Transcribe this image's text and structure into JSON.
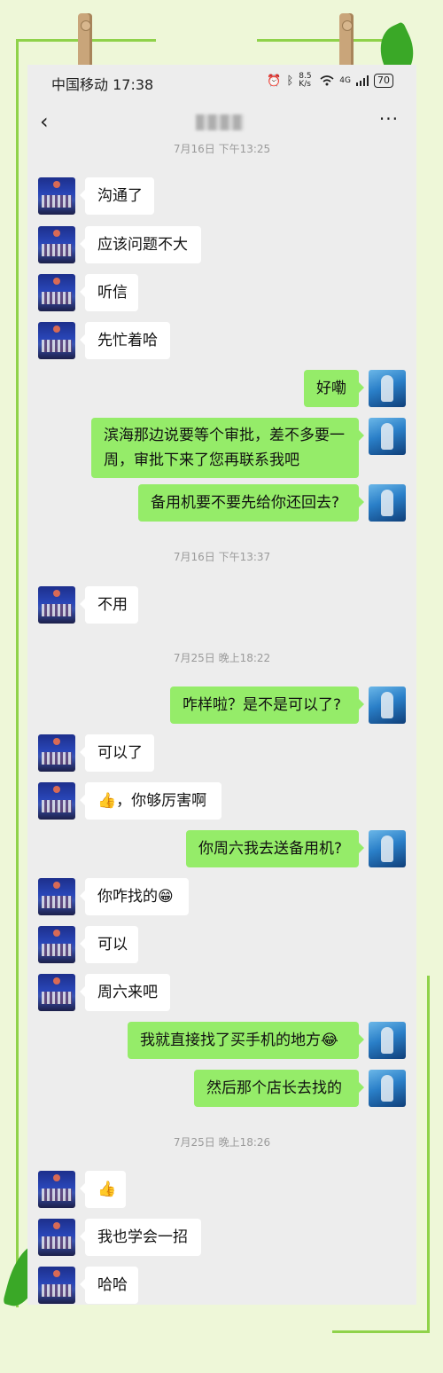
{
  "status_bar": {
    "carrier_time": "中国移动 17:38",
    "icons": [
      "alarm-icon",
      "bluetooth-icon",
      "wifi-icon",
      "signal-icon"
    ],
    "net_speed": "8.5 K/s",
    "network": "4G",
    "battery": "70"
  },
  "nav": {
    "back": "‹",
    "more": "···"
  },
  "timestamps": [
    "7月16日 下午13:25",
    "7月16日 下午13:37",
    "7月25日 晚上18:22",
    "7月25日 晚上18:26"
  ],
  "messages": [
    {
      "from": "other",
      "text": "沟通了"
    },
    {
      "from": "other",
      "text": "应该问题不大"
    },
    {
      "from": "other",
      "text": "听信"
    },
    {
      "from": "other",
      "text": "先忙着哈"
    },
    {
      "from": "me",
      "text": "好嘞"
    },
    {
      "from": "me",
      "text": "滨海那边说要等个审批，差不多要一周，审批下来了您再联系我吧"
    },
    {
      "from": "me",
      "text": "备用机要不要先给你还回去?"
    },
    {
      "from": "other",
      "text": "不用"
    },
    {
      "from": "me",
      "text": "咋样啦？是不是可以了?"
    },
    {
      "from": "other",
      "text": "可以了"
    },
    {
      "from": "other",
      "text": "👍，你够厉害啊"
    },
    {
      "from": "me",
      "text": "你周六我去送备用机?"
    },
    {
      "from": "other",
      "text": "你咋找的😁"
    },
    {
      "from": "other",
      "text": "可以"
    },
    {
      "from": "other",
      "text": "周六来吧"
    },
    {
      "from": "me",
      "text": "我就直接找了买手机的地方😂"
    },
    {
      "from": "me",
      "text": "然后那个店长去找的"
    },
    {
      "from": "other",
      "text": "👍"
    },
    {
      "from": "other",
      "text": "我也学会一招"
    },
    {
      "from": "other",
      "text": "哈哈"
    }
  ],
  "colors": {
    "outgoing_bubble": "#95ec69",
    "incoming_bubble": "#ffffff",
    "chat_background": "#ededed"
  }
}
